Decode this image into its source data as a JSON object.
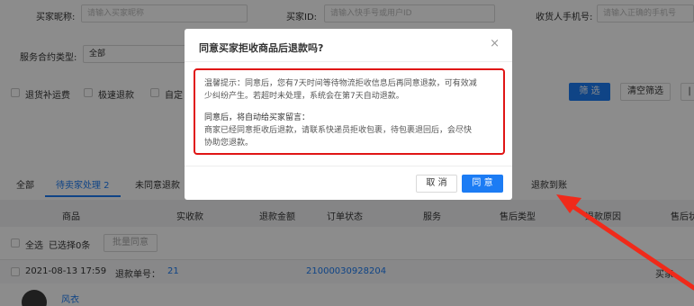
{
  "filters": {
    "buyer_nickname": {
      "label": "买家昵称:",
      "placeholder": "请输入买家昵称"
    },
    "buyer_id": {
      "label": "买家ID:",
      "placeholder": "请输入快手号或用户ID"
    },
    "receiver_phone": {
      "label": "收货人手机号:",
      "placeholder": "请输入正确的手机号"
    },
    "service_contract": {
      "label": "服务合约类型:",
      "value": "全部"
    },
    "checkbox_return_shipping": "退货补运费",
    "checkbox_fast_refund": "极速退款",
    "checkbox_custom": "自定",
    "filter_button": "筛 选",
    "clear_button": "清空筛选",
    "more_button": "|"
  },
  "tabs": [
    {
      "label": "全部"
    },
    {
      "label": "待卖家处理 2"
    },
    {
      "label": "未同意退款"
    },
    {
      "label": "退款到账"
    }
  ],
  "table": {
    "columns": [
      "商品",
      "实收款",
      "退款金额",
      "订单状态",
      "服务",
      "售后类型",
      "退款原因",
      "售后状"
    ],
    "select_all": "全选",
    "selected_count": "已选择0条",
    "batch_agree": "批量同意",
    "order": {
      "datetime": "2021-08-13 17:59",
      "refund_no_label": "退款单号：",
      "refund_no_prefix": "21",
      "refund_no_suffix": "21000030928204",
      "right_label": "买家",
      "product_name": "风衣"
    }
  },
  "modal": {
    "title": "同意买家拒收商品后退款吗?",
    "close_icon": "×",
    "notice_line1": "温馨提示：同意后，您有7天时间等待物流拒收信息后再同意退款，可有效减",
    "notice_line2": "少纠纷产生。若超时未处理，系统会在第7天自动退款。",
    "notice_line3": "同意后，将自动给买家留言：",
    "notice_line4": "商家已经同意拒收后退款，请联系快递员拒收包裹，待包裹退回后，会尽快",
    "notice_line5": "协助您退款。",
    "cancel_button": "取 消",
    "confirm_button": "同 意"
  },
  "colors": {
    "primary": "#1c7cf4",
    "highlight_border": "#e01515",
    "arrow": "#f02a1a"
  }
}
